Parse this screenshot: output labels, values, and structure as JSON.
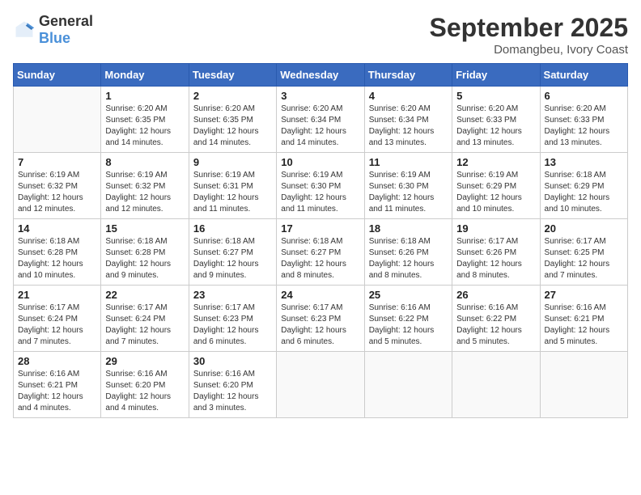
{
  "logo": {
    "general": "General",
    "blue": "Blue"
  },
  "title": "September 2025",
  "subtitle": "Domangbeu, Ivory Coast",
  "weekdays": [
    "Sunday",
    "Monday",
    "Tuesday",
    "Wednesday",
    "Thursday",
    "Friday",
    "Saturday"
  ],
  "weeks": [
    [
      {
        "day": "",
        "info": ""
      },
      {
        "day": "1",
        "info": "Sunrise: 6:20 AM\nSunset: 6:35 PM\nDaylight: 12 hours\nand 14 minutes."
      },
      {
        "day": "2",
        "info": "Sunrise: 6:20 AM\nSunset: 6:35 PM\nDaylight: 12 hours\nand 14 minutes."
      },
      {
        "day": "3",
        "info": "Sunrise: 6:20 AM\nSunset: 6:34 PM\nDaylight: 12 hours\nand 14 minutes."
      },
      {
        "day": "4",
        "info": "Sunrise: 6:20 AM\nSunset: 6:34 PM\nDaylight: 12 hours\nand 13 minutes."
      },
      {
        "day": "5",
        "info": "Sunrise: 6:20 AM\nSunset: 6:33 PM\nDaylight: 12 hours\nand 13 minutes."
      },
      {
        "day": "6",
        "info": "Sunrise: 6:20 AM\nSunset: 6:33 PM\nDaylight: 12 hours\nand 13 minutes."
      }
    ],
    [
      {
        "day": "7",
        "info": "Sunrise: 6:19 AM\nSunset: 6:32 PM\nDaylight: 12 hours\nand 12 minutes."
      },
      {
        "day": "8",
        "info": "Sunrise: 6:19 AM\nSunset: 6:32 PM\nDaylight: 12 hours\nand 12 minutes."
      },
      {
        "day": "9",
        "info": "Sunrise: 6:19 AM\nSunset: 6:31 PM\nDaylight: 12 hours\nand 11 minutes."
      },
      {
        "day": "10",
        "info": "Sunrise: 6:19 AM\nSunset: 6:30 PM\nDaylight: 12 hours\nand 11 minutes."
      },
      {
        "day": "11",
        "info": "Sunrise: 6:19 AM\nSunset: 6:30 PM\nDaylight: 12 hours\nand 11 minutes."
      },
      {
        "day": "12",
        "info": "Sunrise: 6:19 AM\nSunset: 6:29 PM\nDaylight: 12 hours\nand 10 minutes."
      },
      {
        "day": "13",
        "info": "Sunrise: 6:18 AM\nSunset: 6:29 PM\nDaylight: 12 hours\nand 10 minutes."
      }
    ],
    [
      {
        "day": "14",
        "info": "Sunrise: 6:18 AM\nSunset: 6:28 PM\nDaylight: 12 hours\nand 10 minutes."
      },
      {
        "day": "15",
        "info": "Sunrise: 6:18 AM\nSunset: 6:28 PM\nDaylight: 12 hours\nand 9 minutes."
      },
      {
        "day": "16",
        "info": "Sunrise: 6:18 AM\nSunset: 6:27 PM\nDaylight: 12 hours\nand 9 minutes."
      },
      {
        "day": "17",
        "info": "Sunrise: 6:18 AM\nSunset: 6:27 PM\nDaylight: 12 hours\nand 8 minutes."
      },
      {
        "day": "18",
        "info": "Sunrise: 6:18 AM\nSunset: 6:26 PM\nDaylight: 12 hours\nand 8 minutes."
      },
      {
        "day": "19",
        "info": "Sunrise: 6:17 AM\nSunset: 6:26 PM\nDaylight: 12 hours\nand 8 minutes."
      },
      {
        "day": "20",
        "info": "Sunrise: 6:17 AM\nSunset: 6:25 PM\nDaylight: 12 hours\nand 7 minutes."
      }
    ],
    [
      {
        "day": "21",
        "info": "Sunrise: 6:17 AM\nSunset: 6:24 PM\nDaylight: 12 hours\nand 7 minutes."
      },
      {
        "day": "22",
        "info": "Sunrise: 6:17 AM\nSunset: 6:24 PM\nDaylight: 12 hours\nand 7 minutes."
      },
      {
        "day": "23",
        "info": "Sunrise: 6:17 AM\nSunset: 6:23 PM\nDaylight: 12 hours\nand 6 minutes."
      },
      {
        "day": "24",
        "info": "Sunrise: 6:17 AM\nSunset: 6:23 PM\nDaylight: 12 hours\nand 6 minutes."
      },
      {
        "day": "25",
        "info": "Sunrise: 6:16 AM\nSunset: 6:22 PM\nDaylight: 12 hours\nand 5 minutes."
      },
      {
        "day": "26",
        "info": "Sunrise: 6:16 AM\nSunset: 6:22 PM\nDaylight: 12 hours\nand 5 minutes."
      },
      {
        "day": "27",
        "info": "Sunrise: 6:16 AM\nSunset: 6:21 PM\nDaylight: 12 hours\nand 5 minutes."
      }
    ],
    [
      {
        "day": "28",
        "info": "Sunrise: 6:16 AM\nSunset: 6:21 PM\nDaylight: 12 hours\nand 4 minutes."
      },
      {
        "day": "29",
        "info": "Sunrise: 6:16 AM\nSunset: 6:20 PM\nDaylight: 12 hours\nand 4 minutes."
      },
      {
        "day": "30",
        "info": "Sunrise: 6:16 AM\nSunset: 6:20 PM\nDaylight: 12 hours\nand 3 minutes."
      },
      {
        "day": "",
        "info": ""
      },
      {
        "day": "",
        "info": ""
      },
      {
        "day": "",
        "info": ""
      },
      {
        "day": "",
        "info": ""
      }
    ]
  ]
}
